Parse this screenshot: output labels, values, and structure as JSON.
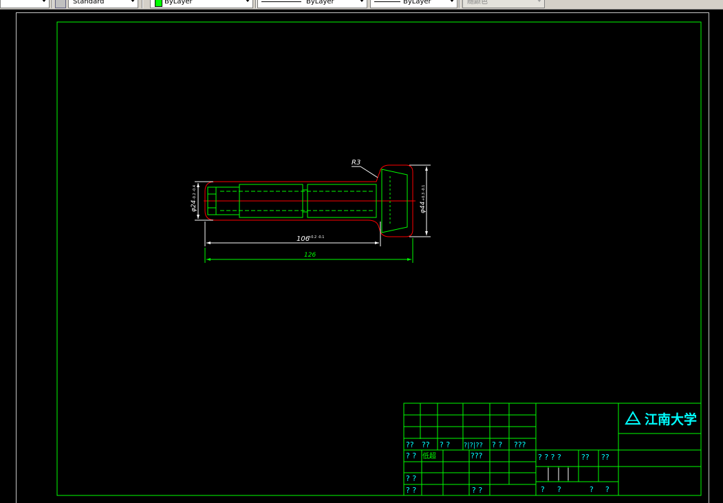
{
  "toolbar": {
    "style_value": "Standard",
    "color_value": "ByLayer",
    "linetype_value": "ByLayer",
    "lineweight_value": "ByLayer",
    "plotstyle_value": "随颜色",
    "color_swatch": "#00ff00"
  },
  "drawing": {
    "colors": {
      "outline": "#ff0000",
      "part": "#00ff00",
      "dimension": "#ffffff",
      "title": "#00ffff"
    },
    "dimensions": {
      "radius": "R3",
      "shaft_diameter": "φ24",
      "shaft_tolerance": "-0.2 -0.4",
      "head_diameter": "φ44",
      "head_tolerance": "+0.3 -0.1",
      "shank_length": "106",
      "shank_tolerance": "+0.2 -0.1",
      "overall_length": "126"
    }
  },
  "title_block": {
    "logo_text": "江南大学",
    "row1": [
      "??",
      "??",
      "? ?",
      "?|?|??",
      "? ?",
      "???"
    ],
    "row2": [
      "? ?",
      "低超",
      "???"
    ],
    "row4": [
      "? ?"
    ],
    "row5": [
      "? ?",
      "? ?"
    ],
    "mid_row": [
      "? ? ? ?",
      "??",
      "??"
    ],
    "bottom_row": [
      "?",
      "?",
      "?",
      "?"
    ]
  }
}
